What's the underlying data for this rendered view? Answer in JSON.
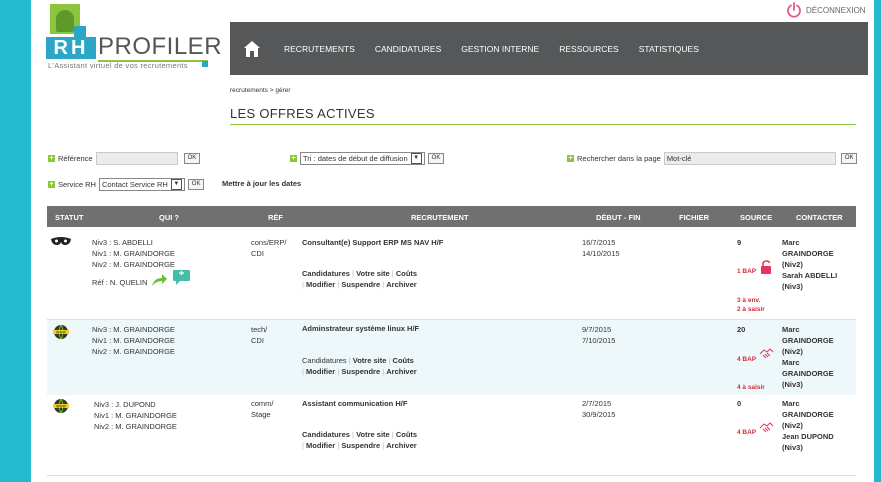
{
  "logo": {
    "rh": "RH",
    "name": "PROFILER",
    "tagline": "L'Assistant virtuel de vos recrutements"
  },
  "logout_label": "DÉCONNEXION",
  "nav": [
    "RECRUTEMENTS",
    "CANDIDATURES",
    "GESTION INTERNE",
    "RESSOURCES",
    "STATISTIQUES"
  ],
  "breadcrumb": "recrutements > gérer",
  "title": "LES OFFRES ACTIVES",
  "filters": {
    "reference_label": "Référence",
    "reference_value": "",
    "sort_value": "Tri : dates de début de diffusion",
    "search_label": "Rechercher dans la page",
    "search_placeholder": "Mot-clé",
    "service_label": "Service RH",
    "service_value": "Contact Service RH",
    "ok": "OK",
    "update_dates": "Mettre à jour les dates"
  },
  "columns": [
    "STATUT",
    "QUI ?",
    "RÉF",
    "RECRUTEMENT",
    "DÉBUT - FIN",
    "FICHIER",
    "SOURCE",
    "CONTACTER"
  ],
  "actions": {
    "candidatures": "Candidatures",
    "site": "Votre site",
    "couts": "Coûts",
    "modifier": "Modifier",
    "suspendre": "Suspendre",
    "archiver": "Archiver"
  },
  "rows": [
    {
      "who": [
        "Niv3 : S. ABDELLI",
        "Niv1 : M. GRAINDORGE",
        "Niv2 : M. GRAINDORGE"
      ],
      "ref_person": "Réf : N. QUELIN",
      "ref": [
        "cons/ERP/",
        "CDI"
      ],
      "job": "Consultant(e) Support ERP MS NAV H/F",
      "dates": [
        "16/7/2015",
        "14/10/2015"
      ],
      "source_count": "9",
      "bap": "1 BAP",
      "extra": [
        "3 à env.",
        "2 à saisir"
      ],
      "contact": [
        "Marc",
        "GRAINDORGE",
        "(Niv2)",
        "Sarah ABDELLI",
        "(Niv3)"
      ]
    },
    {
      "who": [
        "Niv3 : M. GRAINDORGE",
        "Niv1 : M. GRAINDORGE",
        "Niv2 : M. GRAINDORGE"
      ],
      "ref": [
        "tech/",
        "CDI"
      ],
      "job": "Adminstrateur système linux H/F",
      "dates": [
        "9/7/2015",
        "7/10/2015"
      ],
      "source_count": "20",
      "bap": "4 BAP",
      "extra": [
        "4 à saisir"
      ],
      "contact": [
        "Marc",
        "GRAINDORGE",
        "(Niv2)",
        "Marc",
        "GRAINDORGE",
        "(Niv3)"
      ]
    },
    {
      "who": [
        "Niv3 : J. DUPOND",
        "Niv1 : M. GRAINDORGE",
        "Niv2 : M. GRAINDORGE"
      ],
      "ref": [
        "comm/",
        "Stage"
      ],
      "job": "Assistant communication H/F",
      "dates": [
        "2/7/2015",
        "30/9/2015"
      ],
      "source_count": "0",
      "bap": "4 BAP",
      "contact": [
        "Marc",
        "GRAINDORGE",
        "(Niv2)",
        "Jean DUPOND",
        "(Niv3)"
      ]
    }
  ],
  "colors": {
    "accent_cyan": "#25b9cf",
    "nav_bg": "#555759",
    "green": "#8cc63f",
    "red": "#d62a3c",
    "row_alt": "#eef8fb"
  }
}
